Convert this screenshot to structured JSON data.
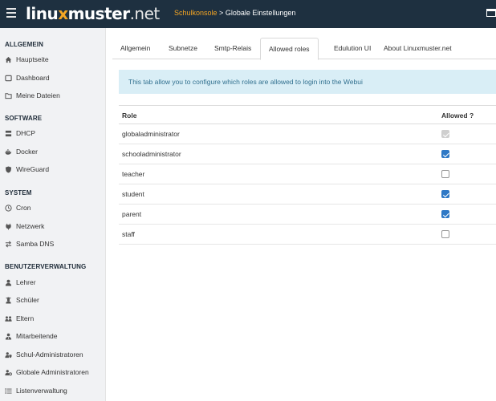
{
  "header": {
    "logo_prefix": "linu",
    "logo_x": "x",
    "logo_middle": "muster",
    "logo_suffix": ".net",
    "breadcrumb_link": "Schulkonsole",
    "breadcrumb_sep": " > ",
    "breadcrumb_current": "Globale Einstellungen",
    "colors": {
      "bg": "#1e3040",
      "accent": "#f5a623"
    }
  },
  "sidebar": {
    "sections": [
      {
        "title": "ALLGEMEIN",
        "items": [
          {
            "label": "Hauptseite",
            "icon": "home-icon"
          },
          {
            "label": "Dashboard",
            "icon": "dashboard-icon"
          },
          {
            "label": "Meine Dateien",
            "icon": "folder-icon"
          }
        ]
      },
      {
        "title": "SOFTWARE",
        "items": [
          {
            "label": "DHCP",
            "icon": "network-icon"
          },
          {
            "label": "Docker",
            "icon": "docker-icon"
          },
          {
            "label": "WireGuard",
            "icon": "shield-icon"
          }
        ]
      },
      {
        "title": "SYSTEM",
        "items": [
          {
            "label": "Cron",
            "icon": "clock-icon"
          },
          {
            "label": "Netzwerk",
            "icon": "plug-icon"
          },
          {
            "label": "Samba DNS",
            "icon": "exchange-icon"
          }
        ]
      },
      {
        "title": "BENUTZERVERWALTUNG",
        "items": [
          {
            "label": "Lehrer",
            "icon": "user-icon"
          },
          {
            "label": "Schüler",
            "icon": "user-graduate-icon"
          },
          {
            "label": "Eltern",
            "icon": "users-icon"
          },
          {
            "label": "Mitarbeitende",
            "icon": "user-tie-icon"
          },
          {
            "label": "Schul-Administratoren",
            "icon": "user-shield-icon"
          },
          {
            "label": "Globale Administratoren",
            "icon": "user-cog-icon"
          },
          {
            "label": "Listenverwaltung",
            "icon": "list-icon"
          }
        ]
      }
    ]
  },
  "tabs": [
    {
      "label": "Allgemein",
      "active": false
    },
    {
      "label": "Subnetze",
      "active": false
    },
    {
      "label": "Smtp-Relais",
      "active": false
    },
    {
      "label": "Allowed roles",
      "active": true
    },
    {
      "label": "Edulution UI",
      "active": false
    },
    {
      "label": "About Linuxmuster.net",
      "active": false
    }
  ],
  "alert": {
    "text": "This tab allow you to configure which roles are allowed to login into the Webui"
  },
  "table": {
    "headers": {
      "role": "Role",
      "allowed": "Allowed ?"
    },
    "rows": [
      {
        "role": "globaladministrator",
        "allowed": true,
        "disabled": true
      },
      {
        "role": "schooladministrator",
        "allowed": true,
        "disabled": false
      },
      {
        "role": "teacher",
        "allowed": false,
        "disabled": false
      },
      {
        "role": "student",
        "allowed": true,
        "disabled": false
      },
      {
        "role": "parent",
        "allowed": true,
        "disabled": false
      },
      {
        "role": "staff",
        "allowed": false,
        "disabled": false
      }
    ]
  },
  "colors": {
    "checkbox": "#2f79c6",
    "alert_bg": "#d9eef6",
    "alert_text": "#31708f"
  }
}
